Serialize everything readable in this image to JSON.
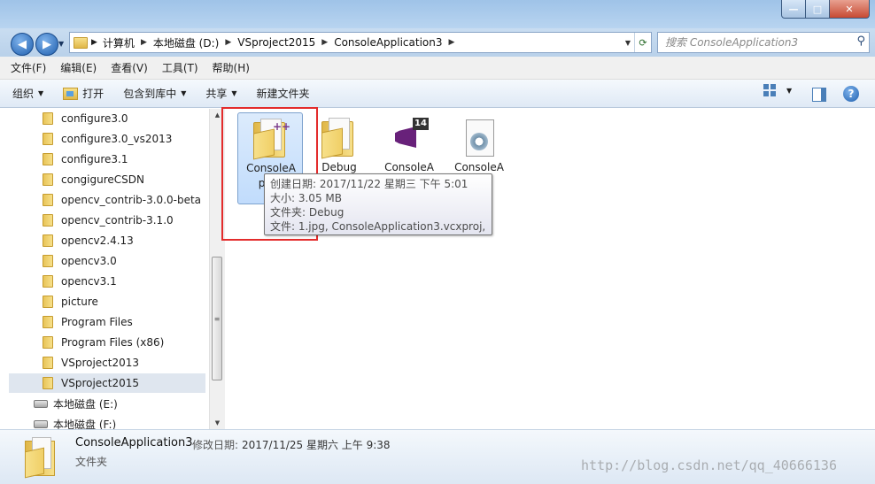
{
  "address": {
    "crumbs": [
      "计算机",
      "本地磁盘 (D:)",
      "VSproject2015",
      "ConsoleApplication3"
    ],
    "search_placeholder": "搜索 ConsoleApplication3"
  },
  "menu": [
    "文件(F)",
    "编辑(E)",
    "查看(V)",
    "工具(T)",
    "帮助(H)"
  ],
  "toolbar": {
    "organize": "组织",
    "open": "打开",
    "include": "包含到库中",
    "share": "共享",
    "new_folder": "新建文件夹"
  },
  "tree": [
    {
      "label": "configure3.0",
      "type": "folder"
    },
    {
      "label": "configure3.0_vs2013",
      "type": "folder"
    },
    {
      "label": "configure3.1",
      "type": "folder"
    },
    {
      "label": "congigureCSDN",
      "type": "folder"
    },
    {
      "label": "opencv_contrib-3.0.0-beta",
      "type": "folder"
    },
    {
      "label": "opencv_contrib-3.1.0",
      "type": "folder"
    },
    {
      "label": "opencv2.4.13",
      "type": "folder"
    },
    {
      "label": "opencv3.0",
      "type": "folder"
    },
    {
      "label": "opencv3.1",
      "type": "folder"
    },
    {
      "label": "picture",
      "type": "folder"
    },
    {
      "label": "Program Files",
      "type": "folder"
    },
    {
      "label": "Program Files (x86)",
      "type": "folder"
    },
    {
      "label": "VSproject2013",
      "type": "folder"
    },
    {
      "label": "VSproject2015",
      "type": "folder",
      "selected": true
    },
    {
      "label": "本地磁盘 (E:)",
      "type": "drive"
    },
    {
      "label": "本地磁盘 (F:)",
      "type": "drive"
    }
  ],
  "files": [
    {
      "label": "ConsoleApplication3",
      "shown": "ConsoleA\npplic",
      "icon": "project-folder-icon"
    },
    {
      "label": "Debug",
      "shown": "Debug",
      "icon": "folder-icon"
    },
    {
      "label": "ConsoleA",
      "shown": "ConsoleA",
      "icon": "visual-studio-solution-icon"
    },
    {
      "label": "ConsoleA",
      "shown": "ConsoleA\non\nb",
      "icon": "project-settings-file-icon"
    }
  ],
  "tooltip": {
    "created": "创建日期: 2017/11/22 星期三 下午 5:01",
    "size": "大小: 3.05 MB",
    "folders": "文件夹: Debug",
    "files": "文件: 1.jpg, ConsoleApplication3.vcxproj, ..."
  },
  "status": {
    "name": "ConsoleApplication3",
    "modified_label": "修改日期:",
    "modified": "2017/11/25 星期六 上午 9:38",
    "type": "文件夹"
  },
  "watermark": "http://blog.csdn.net/qq_40666136",
  "colors": {
    "highlight": "#e32c2c",
    "selection": "#c1dcfc"
  }
}
